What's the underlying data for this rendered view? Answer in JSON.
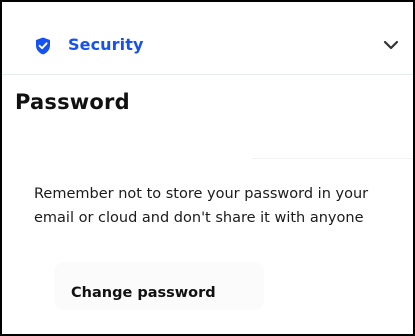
{
  "section": {
    "label": "Security",
    "icon": "shield-check-icon",
    "toggle_icon": "chevron-down-icon"
  },
  "panel": {
    "title": "Password",
    "description": "Remember not to store your password in your email or cloud and don't share it with anyone",
    "button_label": "Change password"
  },
  "colors": {
    "accent": "#1652f0",
    "text": "#111111",
    "border": "#000000"
  }
}
